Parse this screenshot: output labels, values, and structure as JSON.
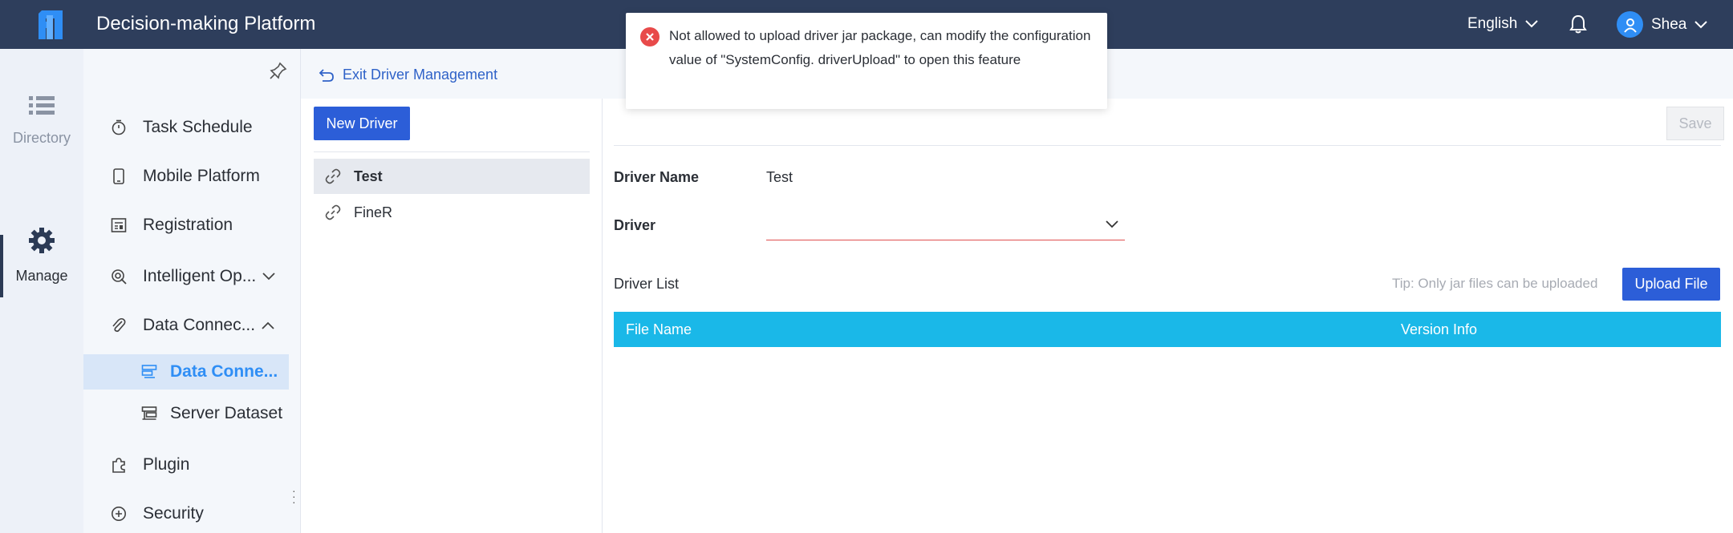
{
  "header": {
    "app_title": "Decision-making Platform",
    "language": "English",
    "user_name": "Shea",
    "brand_color": "#2e3e5c"
  },
  "rail": {
    "items": [
      {
        "label": "Directory",
        "icon": "list-icon"
      },
      {
        "label": "Manage",
        "icon": "gear-icon"
      }
    ]
  },
  "menu": {
    "items": [
      {
        "label": "Task Schedule",
        "icon": "stopwatch-icon"
      },
      {
        "label": "Mobile Platform",
        "icon": "mobile-icon"
      },
      {
        "label": "Registration",
        "icon": "registration-icon"
      },
      {
        "label": "Intelligent Op...",
        "icon": "intelligent-ops-icon"
      },
      {
        "label": "Data Connec...",
        "icon": "paperclip-icon"
      },
      {
        "label": "Data Conne...",
        "icon": "data-connection-icon"
      },
      {
        "label": "Server Dataset",
        "icon": "server-dataset-icon"
      },
      {
        "label": "Plugin",
        "icon": "puzzle-icon"
      },
      {
        "label": "Security",
        "icon": "shield-icon"
      }
    ]
  },
  "main": {
    "exit_label": "Exit Driver Management",
    "new_driver_label": "New Driver",
    "drivers": [
      {
        "name": "Test",
        "selected": true
      },
      {
        "name": "FineR",
        "selected": false
      }
    ],
    "save_label": "Save",
    "driver_name_label": "Driver Name",
    "driver_name_value": "Test",
    "driver_label": "Driver",
    "driver_list_label": "Driver List",
    "tip": "Tip: Only jar files can be uploaded",
    "upload_label": "Upload File",
    "table_headers": [
      "File Name",
      "Version Info"
    ],
    "table_header_color": "#1ab8e8"
  },
  "toast": {
    "type": "error",
    "message": "Not allowed to upload driver jar package, can modify the configuration value of \"SystemConfig. driverUpload\" to open this feature"
  }
}
